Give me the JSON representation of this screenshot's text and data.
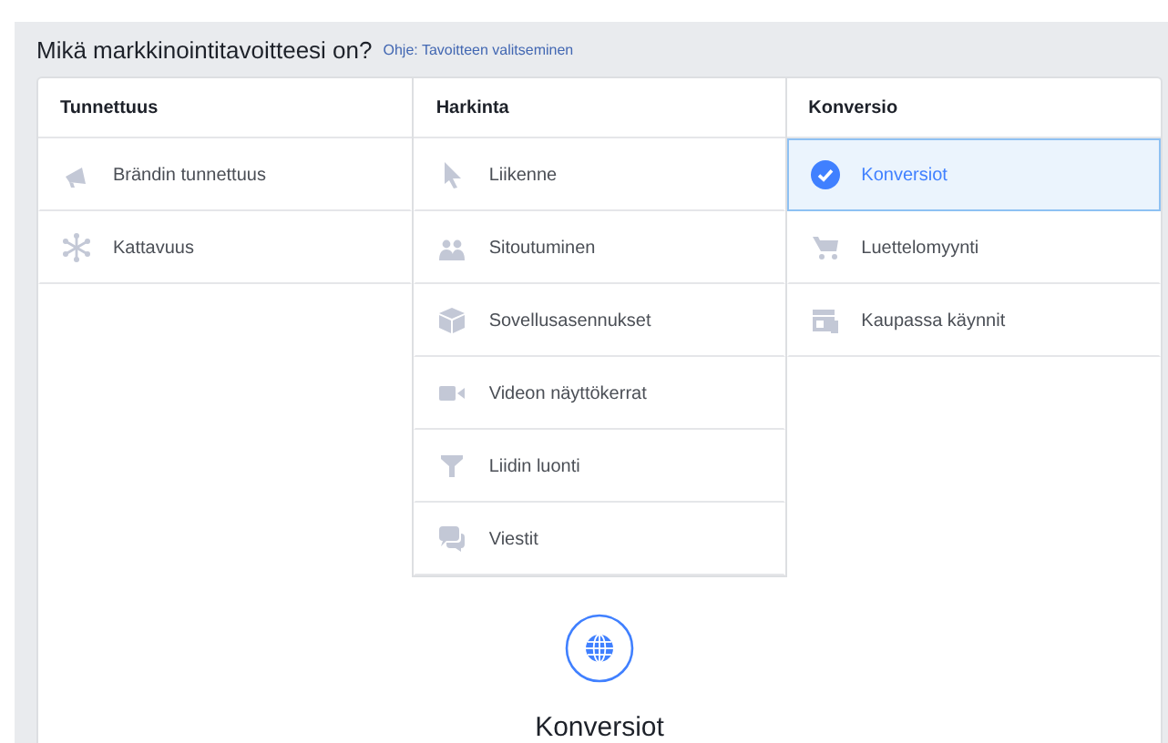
{
  "heading": {
    "title": "Mikä markkinointitavoitteesi on?",
    "help_link": "Ohje: Tavoitteen valitseminen"
  },
  "columns": [
    {
      "title": "Tunnettuus",
      "items": [
        {
          "label": "Brändin tunnettuus",
          "selected": false
        },
        {
          "label": "Kattavuus",
          "selected": false
        }
      ]
    },
    {
      "title": "Harkinta",
      "items": [
        {
          "label": "Liikenne",
          "selected": false
        },
        {
          "label": "Sitoutuminen",
          "selected": false
        },
        {
          "label": "Sovellusasennukset",
          "selected": false
        },
        {
          "label": "Videon näyttökerrat",
          "selected": false
        },
        {
          "label": "Liidin luonti",
          "selected": false
        },
        {
          "label": "Viestit",
          "selected": false
        }
      ]
    },
    {
      "title": "Konversio",
      "items": [
        {
          "label": "Konversiot",
          "selected": true
        },
        {
          "label": "Luettelomyynti",
          "selected": false
        },
        {
          "label": "Kaupassa käynnit",
          "selected": false
        }
      ]
    }
  ],
  "detail": {
    "title": "Konversiot"
  }
}
